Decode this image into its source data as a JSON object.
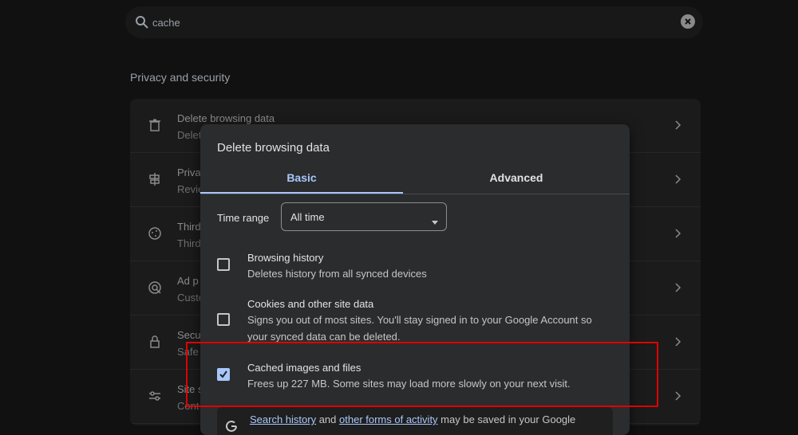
{
  "search": {
    "value": "cache"
  },
  "section": {
    "title": "Privacy and security"
  },
  "settings_rows": [
    {
      "title": "Delete browsing data",
      "subtitle": "Delet",
      "icon": "trash-icon"
    },
    {
      "title": "Priva",
      "subtitle": "Revie",
      "icon": "privacy-guide-icon"
    },
    {
      "title": "Third",
      "subtitle": "Third",
      "icon": "cookie-icon"
    },
    {
      "title": "Ad p",
      "subtitle": "Custo",
      "icon": "ad-privacy-icon"
    },
    {
      "title": "Secu",
      "subtitle": "Safe",
      "icon": "lock-icon"
    },
    {
      "title": "Site s",
      "subtitle": "Cont",
      "icon": "sliders-icon"
    }
  ],
  "dialog": {
    "title": "Delete browsing data",
    "tabs": {
      "basic": "Basic",
      "advanced": "Advanced"
    },
    "time_range": {
      "label": "Time range",
      "value": "All time"
    },
    "options": [
      {
        "title": "Browsing history",
        "description": "Deletes history from all synced devices",
        "checked": false
      },
      {
        "title": "Cookies and other site data",
        "description": "Signs you out of most sites. You'll stay signed in to your Google Account so your synced data can be deleted.",
        "checked": false
      },
      {
        "title": "Cached images and files",
        "description": "Frees up 227 MB. Some sites may load more slowly on your next visit.",
        "checked": true
      }
    ],
    "info": {
      "link1": "Search history",
      "text1": " and ",
      "link2": "other forms of activity",
      "text2": " may be saved in your Google"
    }
  },
  "colors": {
    "accent": "#a8c7fa",
    "highlight": "#e00000",
    "dialog_bg": "#2b2c2e",
    "page_bg": "#111111"
  }
}
